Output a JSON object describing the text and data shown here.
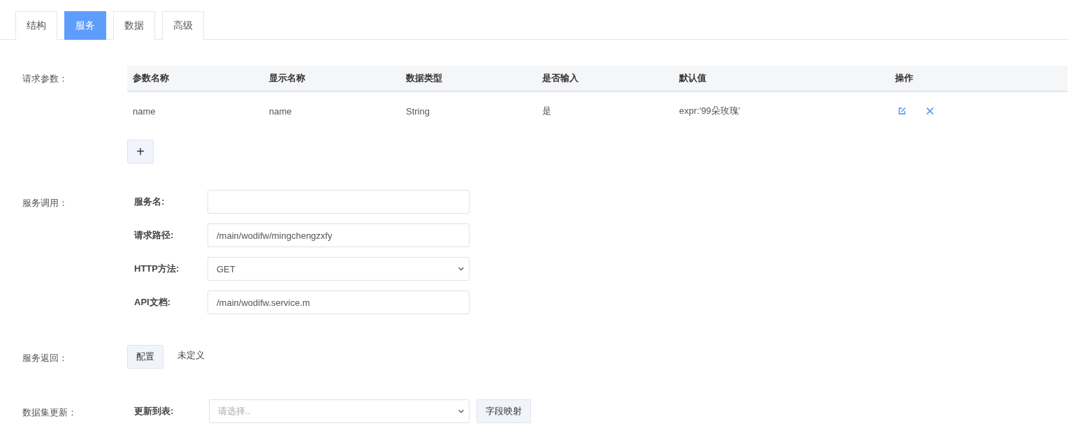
{
  "tabs": [
    {
      "label": "结构",
      "selected": false
    },
    {
      "label": "服务",
      "selected": true
    },
    {
      "label": "数据",
      "selected": false
    },
    {
      "label": "高级",
      "selected": false
    }
  ],
  "request_params": {
    "label": "请求参数：",
    "columns": [
      "参数名称",
      "显示名称",
      "数据类型",
      "是否输入",
      "默认值",
      "操作"
    ],
    "rows": [
      {
        "cells": [
          "name",
          "name",
          "String",
          "是",
          "expr:'99朵玫瑰'"
        ]
      }
    ],
    "add_button": "+"
  },
  "service_call": {
    "label": "服务调用：",
    "fields": [
      {
        "kind": "input",
        "label": "服务名:"
      },
      {
        "kind": "input",
        "label": "请求路径:",
        "value": "/main/wodifw/mingchengzxfy"
      },
      {
        "kind": "select",
        "label": "HTTP方法:",
        "value": "GET"
      },
      {
        "kind": "input",
        "label": "API文档:",
        "value": "/main/wodifw.service.m"
      }
    ]
  },
  "service_return": {
    "label": "服务返回：",
    "button": "配置",
    "status": "未定义"
  },
  "dataset_update": {
    "label": "数据集更新：",
    "field_label": "更新到表:",
    "select": {
      "placeholder": "请选择.."
    },
    "button": "字段映射"
  }
}
